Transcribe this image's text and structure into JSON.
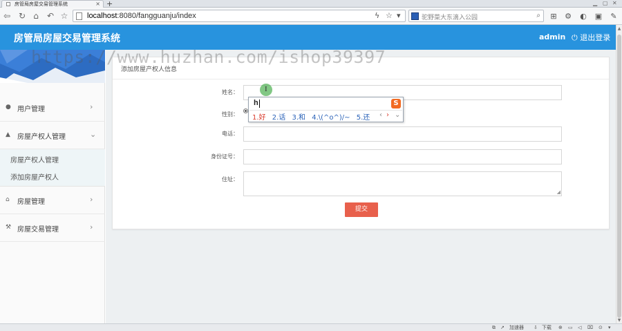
{
  "browser": {
    "tab_title": "房管局房屋交易管理系统",
    "tab_close": "×",
    "new_tab": "+",
    "url_host": "localhost",
    "url_rest": ":8080/fangguanju/index",
    "search_placeholder": "驼野菜大东滴入公园",
    "status_items": [
      "加速器",
      "下载"
    ]
  },
  "header": {
    "title": "房管局房屋交易管理系统",
    "user": "admin",
    "logout": "退出登录"
  },
  "watermark": "https://www.huzhan.com/ishop39397",
  "sidebar": {
    "items": [
      {
        "label": "用户管理",
        "icon": "user-icon",
        "arrow": "›"
      },
      {
        "label": "房屋产权人管理",
        "icon": "owner-icon",
        "arrow": "⌄"
      },
      {
        "label": "房屋管理",
        "icon": "home-icon",
        "arrow": "›"
      },
      {
        "label": "房屋交易管理",
        "icon": "gavel-icon",
        "arrow": "›"
      }
    ],
    "submenu": [
      "房屋产权人管理",
      "添加房屋产权人"
    ]
  },
  "form": {
    "title": "添加房屋产权人信息",
    "fields": [
      {
        "label": "姓名：",
        "value": ""
      },
      {
        "label": "性别：",
        "value": ""
      },
      {
        "label": "电话：",
        "value": ""
      },
      {
        "label": "身份证号：",
        "value": ""
      },
      {
        "label": "住址：",
        "value": ""
      }
    ],
    "submit": "提交"
  },
  "ime": {
    "input": "h",
    "candidates": [
      "1.好",
      "2.话",
      "3.和",
      "4.\\(^o^)/~",
      "5.还"
    ],
    "logo": "S",
    "prev": "‹",
    "next": "›",
    "more": "⌄"
  }
}
